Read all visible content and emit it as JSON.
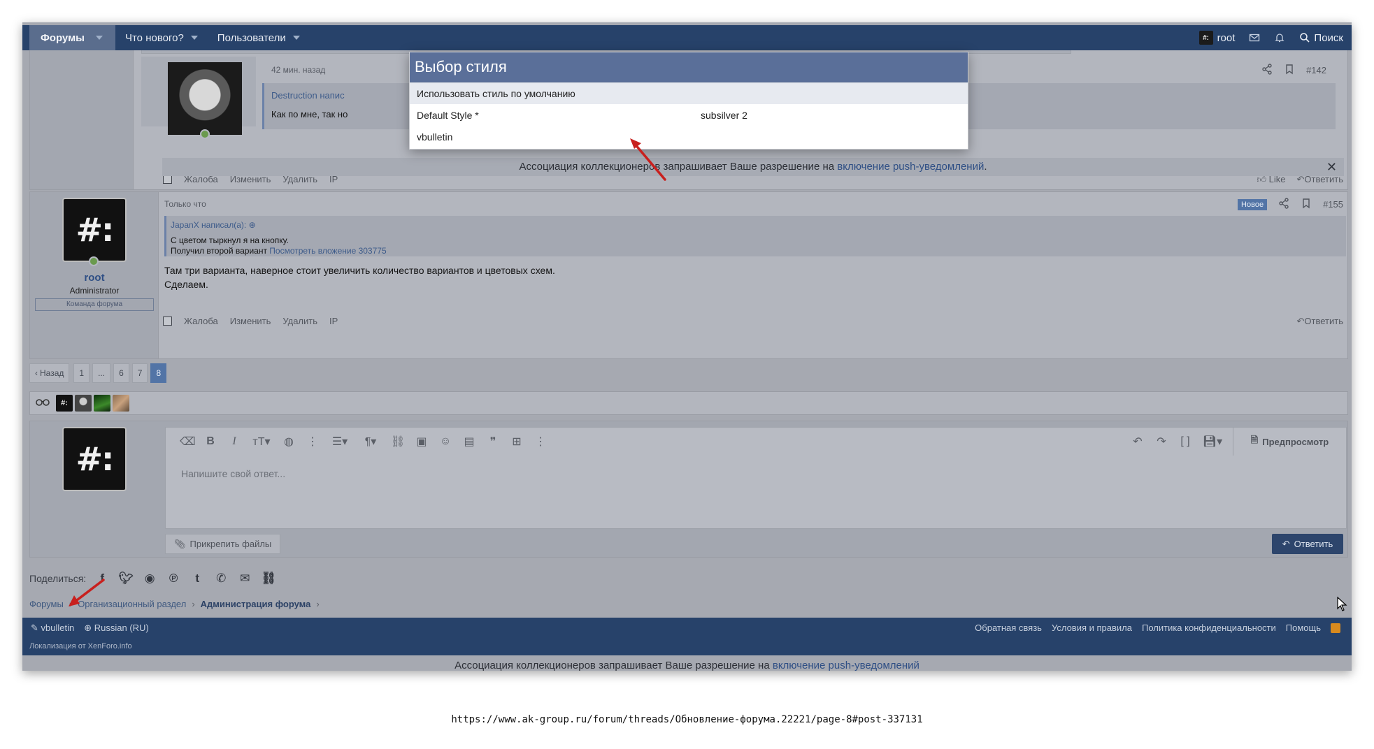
{
  "nav": {
    "forums": "Форумы",
    "whats_new": "Что нового?",
    "members": "Пользователи",
    "user": "root",
    "search": "Поиск"
  },
  "post1": {
    "time": "42 мин. назад",
    "number": "#142",
    "quote_author": "Destruction напис",
    "quote_text": "Как по мне, так но",
    "actions": [
      "Жалоба",
      "Изменить",
      "Удалить",
      "IP"
    ],
    "like": "Like",
    "reply": "Ответить"
  },
  "push": {
    "text": "Ассоциация коллекционеров запрашивает Ваше разрешение на ",
    "link": "включение push-уведомлений",
    "end": "."
  },
  "post2": {
    "time": "Только что",
    "badge": "Новое",
    "number": "#155",
    "user_name": "root",
    "user_title": "Administrator",
    "user_banner": "Команда форума",
    "quote_author": "JapanX написал(а):",
    "quote_line1": "С цветом тыркнул я на кнопку.",
    "quote_line2": "Получил второй вариант ",
    "quote_link": "Посмотреть вложение 303775",
    "body_line1": "Там три варианта, наверное стоит увеличить количество вариантов и цветовых схем.",
    "body_line2": "Сделаем.",
    "actions": [
      "Жалоба",
      "Изменить",
      "Удалить",
      "IP"
    ],
    "reply": "Ответить"
  },
  "pagination": {
    "prev": "Назад",
    "pages": [
      "1",
      "...",
      "6",
      "7",
      "8"
    ],
    "current": "8"
  },
  "editor": {
    "placeholder": "Напишите свой ответ...",
    "preview": "Предпросмотр",
    "attach": "Прикрепить файлы",
    "reply": "Ответить"
  },
  "share": {
    "label": "Поделиться:"
  },
  "breadcrumb": {
    "items": [
      "Форумы",
      "Организационный раздел",
      "Администрация форума"
    ]
  },
  "footer": {
    "style": "vbulletin",
    "language": "Russian (RU)",
    "links": [
      "Обратная связь",
      "Условия и правила",
      "Политика конфиденциальности",
      "Помощь"
    ],
    "credit": "Локализация от XenForo.info"
  },
  "modal": {
    "title": "Выбор стиля",
    "rows": [
      {
        "label": "Использовать стиль по умолчанию",
        "col2": ""
      },
      {
        "label": "Default Style *",
        "col2": "subsilver 2"
      },
      {
        "label": "vbulletin",
        "col2": ""
      }
    ]
  },
  "url": "https://www.ak-group.ru/forum/threads/Обновление-форума.22221/page-8#post-337131",
  "colors": {
    "nav_bg": "#27426a",
    "modal_title_bg": "#5a6f99",
    "arrow": "#c8201e"
  }
}
